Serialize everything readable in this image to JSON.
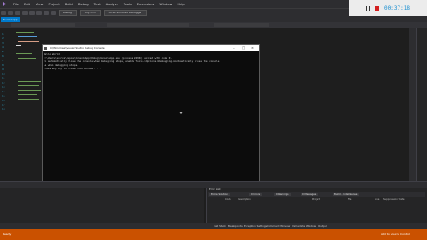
{
  "menu": {
    "items": [
      "File",
      "Edit",
      "View",
      "Project",
      "Build",
      "Debug",
      "Test",
      "Analyze",
      "Tools",
      "Extensions",
      "Window",
      "Help"
    ]
  },
  "toolbar": {
    "config": "Debug",
    "platform": "Any CPU",
    "run_target": "Local Windows Debugger"
  },
  "recorder": {
    "time": "00:37:18"
  },
  "editor_tab": {
    "label": "Source.cpp"
  },
  "console": {
    "title": "C:\\Windows\\Visual Studio Debug Console",
    "lines": [
      "Hello World!",
      "C:\\Users\\source\\repos\\ConsoleApp\\Debug\\ConsoleApp.exe (process 24904) exited with code 0.",
      "To automatically close the console when debugging stops, enable Tools->Options->Debugging->Automatically close the console",
      "le when debugging stops.",
      "Press any key to close this window . . ."
    ]
  },
  "panels": {
    "error_list_title": "Error List",
    "solution_filter": "Entire Solution",
    "errors": "0 Errors",
    "warnings": "0 Warnings",
    "messages": "0 Messages",
    "build_filter": "Build + IntelliSense",
    "headers": [
      "Code",
      "Description",
      "Project",
      "File",
      "Line",
      "Suppression State"
    ]
  },
  "bottom_tabs": [
    "Call Stack",
    "Breakpoints",
    "Exception Settings",
    "Command Window",
    "Immediate Window",
    "Output"
  ],
  "status": {
    "left": "Ready",
    "right": "Add to Source Control"
  },
  "colors": {
    "statusbar": "#ca5100",
    "accent": "#007acc",
    "stop": "#d31f1f"
  }
}
